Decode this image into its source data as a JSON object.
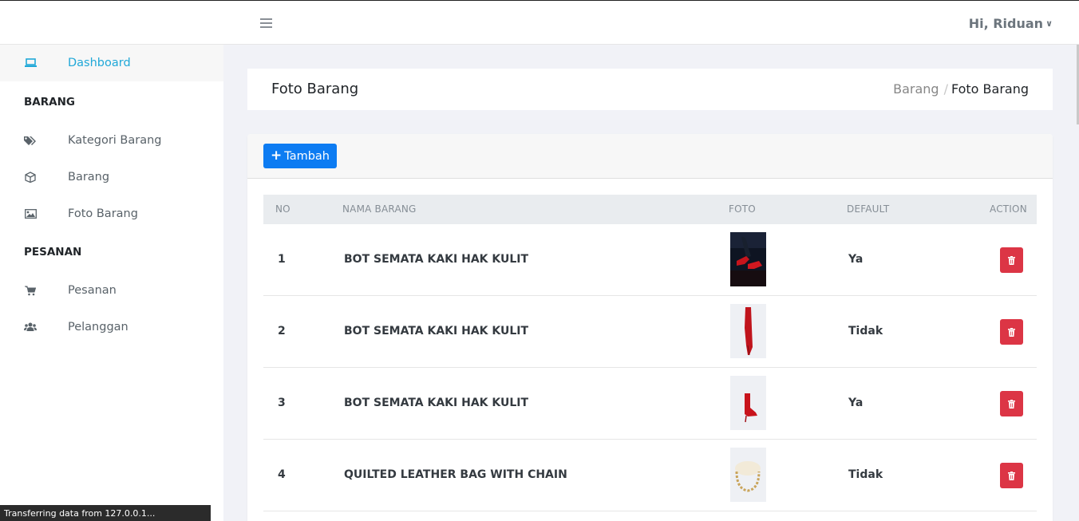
{
  "topbar": {
    "user_greeting": "Hi, Riduan"
  },
  "sidebar": {
    "dashboard": "Dashboard",
    "section_barang": "BARANG",
    "kategori_barang": "Kategori Barang",
    "barang": "Barang",
    "foto_barang": "Foto Barang",
    "section_pesanan": "PESANAN",
    "pesanan": "Pesanan",
    "pelanggan": "Pelanggan"
  },
  "page": {
    "title": "Foto Barang",
    "breadcrumb": [
      "Barang",
      "Foto Barang"
    ]
  },
  "card": {
    "add_label": "Tambah"
  },
  "table": {
    "columns": [
      "NO",
      "NAMA BARANG",
      "FOTO",
      "DEFAULT",
      "ACTION"
    ],
    "rows": [
      {
        "no": "1",
        "name": "BOT SEMATA KAKI HAK KULIT",
        "default": "Ya"
      },
      {
        "no": "2",
        "name": "BOT SEMATA KAKI HAK KULIT",
        "default": "Tidak"
      },
      {
        "no": "3",
        "name": "BOT SEMATA KAKI HAK KULIT",
        "default": "Ya"
      },
      {
        "no": "4",
        "name": "QUILTED LEATHER BAG WITH CHAIN",
        "default": "Tidak"
      }
    ]
  },
  "statusbar": {
    "text": "Transferring data from 127.0.0.1..."
  },
  "colors": {
    "accent": "#20a8d8",
    "primary_button": "#0d7cf2",
    "danger": "#dc3545"
  }
}
